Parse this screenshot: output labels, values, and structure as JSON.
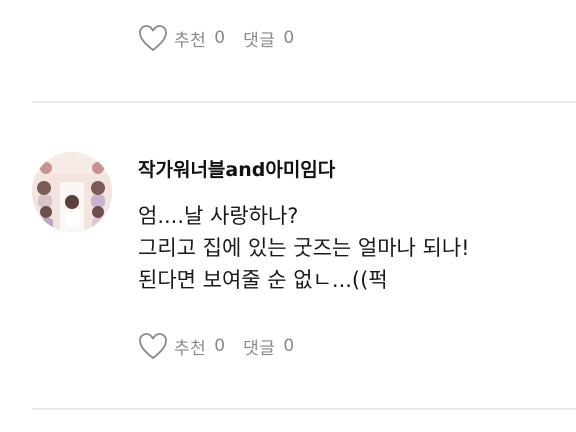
{
  "post_actions": {
    "like_label": "추천",
    "like_count": "0",
    "comment_label": "댓글",
    "comment_count": "0"
  },
  "comment": {
    "username": "작가워너블and아미임다",
    "lines": [
      "엄....날 사랑하나?",
      "그리고 집에 있는 굿즈는 얼마나 되나!",
      "된다면 보여줄 순 없ㄴ...((퍽"
    ],
    "like_label": "추천",
    "like_count": "0",
    "comment_label": "댓글",
    "comment_count": "0"
  },
  "colors": {
    "icon_gray": "#8a8a8a",
    "divider": "#e6e8ea"
  },
  "icons": [
    "heart-outline-icon"
  ]
}
